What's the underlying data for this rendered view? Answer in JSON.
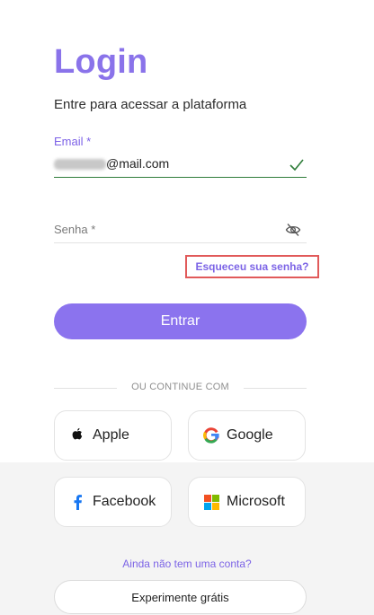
{
  "login": {
    "title": "Login",
    "subtitle": "Entre para acessar a plataforma",
    "email": {
      "label": "Email *",
      "value_suffix": "@mail.com"
    },
    "password": {
      "label": "Senha *"
    },
    "forgot_password": "Esqueceu sua senha?",
    "submit_label": "Entrar",
    "divider_text": "OU CONTINUE COM",
    "social": {
      "apple": "Apple",
      "google": "Google",
      "facebook": "Facebook",
      "microsoft": "Microsoft"
    },
    "no_account_text": "Ainda não tem uma conta?",
    "trial_label": "Experimente grátis"
  },
  "colors": {
    "accent": "#8b73ee",
    "success": "#2f7d3a",
    "highlight_border": "#e15a5a"
  }
}
